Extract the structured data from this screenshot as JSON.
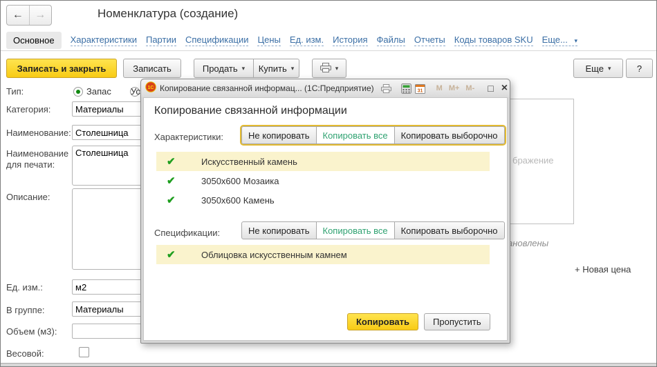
{
  "header": {
    "title": "Номенклатура (создание)"
  },
  "icons": {
    "back": "←",
    "forward": "→",
    "caret": "▾",
    "check": "✔",
    "maximize": "□",
    "close": "×"
  },
  "tabs": {
    "items": [
      "Основное",
      "Характеристики",
      "Партии",
      "Спецификации",
      "Цены",
      "Ед. изм.",
      "История",
      "Файлы",
      "Отчеты",
      "Коды товаров SKU"
    ],
    "more": "Еще..."
  },
  "toolbar": {
    "save_and_close": "Записать и закрыть",
    "save": "Записать",
    "sell": "Продать",
    "buy": "Купить",
    "more": "Еще",
    "help": "?"
  },
  "form": {
    "type_label": "Тип:",
    "type_options": [
      {
        "label": "Запас",
        "selected": true
      },
      {
        "label": "Ус",
        "selected": false
      }
    ],
    "category_label": "Категория:",
    "category_value": "Материалы",
    "name_label": "Наименование:",
    "name_value": "Столешница",
    "print_name_label": "Наименование для печати:",
    "print_name_value": "Столешница",
    "description_label": "Описание:",
    "description_value": "",
    "unit_label": "Ед. изм.:",
    "unit_value": "м2",
    "group_label": "В группе:",
    "group_value": "Материалы",
    "volume_label": "Объем (м3):",
    "volume_value": "",
    "weight_label": "Весовой:"
  },
  "right_panel": {
    "image_placeholder_fragment": "бражение",
    "prices_note_fragment": "ановлены",
    "new_price_link": "+ Новая цена"
  },
  "dialog": {
    "titlebar": {
      "title": "Копирование связанной информац... (1С:Предприятие)",
      "memory_buttons": [
        "M",
        "M+",
        "M-"
      ]
    },
    "heading": "Копирование связанной информации",
    "sections": [
      {
        "label": "Характеристики:",
        "options": [
          "Не копировать",
          "Копировать все",
          "Копировать выборочно"
        ],
        "selected": "Копировать все",
        "items": [
          "Искусственный камень",
          "3050х600 Мозаика",
          "3050х600 Камень"
        ]
      },
      {
        "label": "Спецификации:",
        "options": [
          "Не копировать",
          "Копировать все",
          "Копировать выборочно"
        ],
        "selected": "Копировать все",
        "items": [
          "Облицовка искусственным камнем"
        ]
      }
    ],
    "copy_button": "Копировать",
    "skip_button": "Пропустить"
  },
  "colors": {
    "accent_yellow": "#F8CB15",
    "link_blue": "#3A6EA5",
    "green_check": "#1E9E1E",
    "green_selected": "#2FA271",
    "row_highlight": "#FAF3CD",
    "focus_ring": "#E3BB31"
  }
}
